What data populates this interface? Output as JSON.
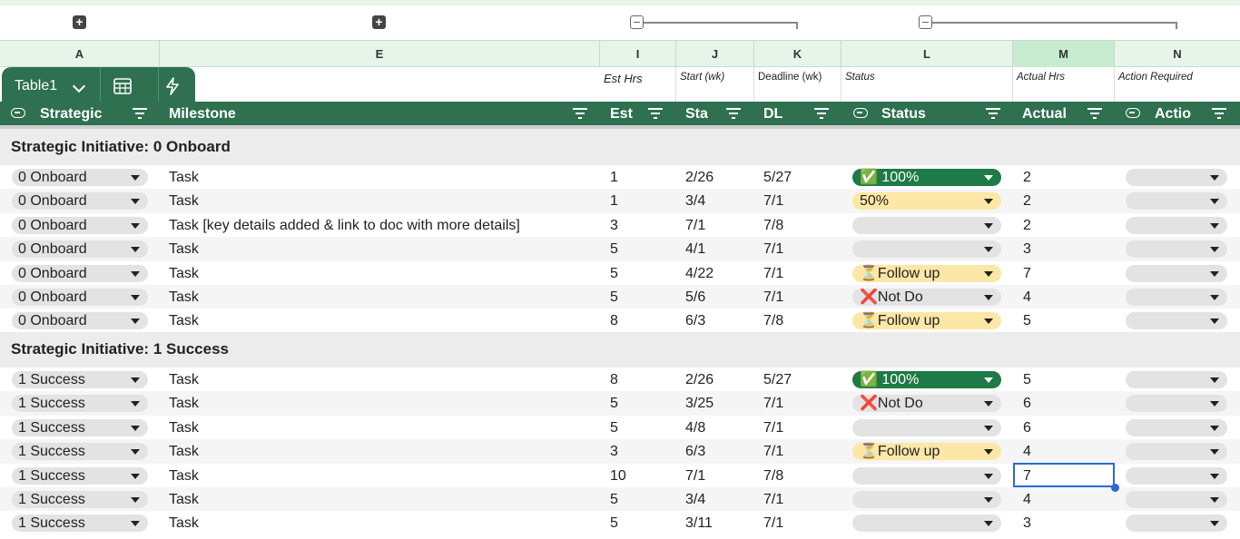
{
  "columns": [
    "A",
    "E",
    "I",
    "J",
    "K",
    "L",
    "M",
    "N"
  ],
  "column_hints": [
    "Est Hrs",
    "Start (wk)",
    "Deadline (wk)",
    "Status",
    "Actual Hrs",
    "Action Required"
  ],
  "table": {
    "name": "Table1"
  },
  "headers": {
    "strategic": "Strategic",
    "milestone": "Milestone",
    "est": "Est",
    "start": "Sta",
    "deadline": "DL",
    "status": "Status",
    "actual": "Actual",
    "action": "Actio"
  },
  "groups": [
    {
      "title": "Strategic Initiative: 0 Onboard",
      "rows": [
        {
          "strategic": "0 Onboard",
          "milestone": "Task",
          "est": "1",
          "start": "2/26",
          "dl": "5/27",
          "status": "✅ 100%",
          "status_kind": "done",
          "actual": "2"
        },
        {
          "strategic": "0 Onboard",
          "milestone": "Task",
          "est": "1",
          "start": "3/4",
          "dl": "7/1",
          "status": "50%",
          "status_kind": "half",
          "actual": "2"
        },
        {
          "strategic": "0 Onboard",
          "milestone": "Task [key details added & link to doc with more details]",
          "est": "3",
          "start": "7/1",
          "dl": "7/8",
          "status": "",
          "status_kind": "empty",
          "actual": "2"
        },
        {
          "strategic": "0 Onboard",
          "milestone": "Task",
          "est": "5",
          "start": "4/1",
          "dl": "7/1",
          "status": "",
          "status_kind": "empty",
          "actual": "3"
        },
        {
          "strategic": "0 Onboard",
          "milestone": "Task",
          "est": "5",
          "start": "4/22",
          "dl": "7/1",
          "status": "⏳Follow up",
          "status_kind": "follow",
          "actual": "7"
        },
        {
          "strategic": "0 Onboard",
          "milestone": "Task",
          "est": "5",
          "start": "5/6",
          "dl": "7/1",
          "status": "❌Not Do",
          "status_kind": "notdo",
          "actual": "4"
        },
        {
          "strategic": "0 Onboard",
          "milestone": "Task",
          "est": "8",
          "start": "6/3",
          "dl": "7/8",
          "status": "⏳Follow up",
          "status_kind": "follow",
          "actual": "5"
        }
      ]
    },
    {
      "title": "Strategic Initiative: 1 Success",
      "rows": [
        {
          "strategic": "1 Success",
          "milestone": "Task",
          "est": "8",
          "start": "2/26",
          "dl": "5/27",
          "status": "✅ 100%",
          "status_kind": "done",
          "actual": "5"
        },
        {
          "strategic": "1 Success",
          "milestone": "Task",
          "est": "5",
          "start": "3/25",
          "dl": "7/1",
          "status": "❌Not Do",
          "status_kind": "notdo",
          "actual": "6"
        },
        {
          "strategic": "1 Success",
          "milestone": "Task",
          "est": "5",
          "start": "4/8",
          "dl": "7/1",
          "status": "",
          "status_kind": "empty",
          "actual": "6"
        },
        {
          "strategic": "1 Success",
          "milestone": "Task",
          "est": "3",
          "start": "6/3",
          "dl": "7/1",
          "status": "⏳Follow up",
          "status_kind": "follow",
          "actual": "4"
        },
        {
          "strategic": "1 Success",
          "milestone": "Task",
          "est": "10",
          "start": "7/1",
          "dl": "7/8",
          "status": "",
          "status_kind": "empty",
          "actual": "7"
        },
        {
          "strategic": "1 Success",
          "milestone": "Task",
          "est": "5",
          "start": "3/4",
          "dl": "7/1",
          "status": "",
          "status_kind": "empty",
          "actual": "4"
        },
        {
          "strategic": "1 Success",
          "milestone": "Task",
          "est": "5",
          "start": "3/11",
          "dl": "7/1",
          "status": "",
          "status_kind": "empty",
          "actual": "3"
        }
      ]
    }
  ],
  "colors": {
    "header_green": "#2e7050",
    "status_done": "#1e7a46",
    "status_yellow": "#fde7a6",
    "selection": "#2a6bd1"
  }
}
